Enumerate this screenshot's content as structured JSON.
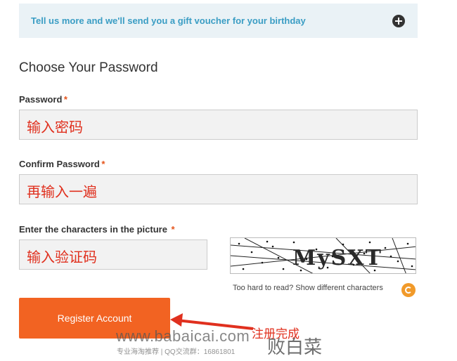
{
  "banner": {
    "text": "Tell us more and we'll send you a gift voucher for your birthday",
    "expand_icon": "plus-circle-icon"
  },
  "section": {
    "title": "Choose Your Password"
  },
  "fields": {
    "password": {
      "label": "Password",
      "required_mark": "*",
      "value": "输入密码"
    },
    "confirm_password": {
      "label": "Confirm Password",
      "required_mark": "*",
      "value": "再输入一遍"
    },
    "captcha": {
      "label": "Enter the characters in the picture",
      "required_mark": "*",
      "value": "输入验证码"
    }
  },
  "captcha_image": {
    "text": "MySXT",
    "refresh_label": "Too hard to read? Show different characters",
    "refresh_icon": "refresh-icon"
  },
  "register_button": {
    "label": "Register Account"
  },
  "annotation": {
    "note": "注册完成",
    "accent_color": "#e0301e"
  },
  "watermark": {
    "url": "www.babaicai.com",
    "subtext": "专业海淘推荐 | QQ交流群：16861801",
    "brand": "败白菜"
  },
  "colors": {
    "banner_bg": "#eaf2f6",
    "banner_text": "#3a9dc4",
    "button": "#f26322",
    "required": "#e5541b"
  }
}
